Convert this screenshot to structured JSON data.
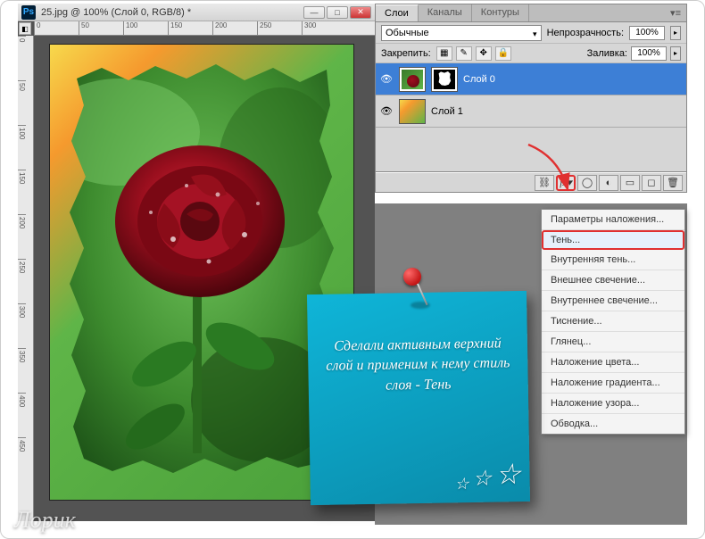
{
  "window": {
    "title": "25.jpg @ 100% (Слой 0, RGB/8) *"
  },
  "ruler_h": [
    "0",
    "50",
    "100",
    "150",
    "200",
    "250",
    "300"
  ],
  "ruler_v": [
    "0",
    "50",
    "100",
    "150",
    "200",
    "250",
    "300",
    "350",
    "400",
    "450"
  ],
  "panel": {
    "tabs": {
      "layers": "Слои",
      "channels": "Каналы",
      "paths": "Контуры"
    },
    "blend_mode": "Обычные",
    "opacity_label": "Непрозрачность:",
    "opacity_value": "100%",
    "lock_label": "Закрепить:",
    "fill_label": "Заливка:",
    "fill_value": "100%",
    "layers": [
      {
        "name": "Слой 0"
      },
      {
        "name": "Слой 1"
      }
    ]
  },
  "fx_menu": {
    "items": [
      "Параметры наложения...",
      "Тень...",
      "Внутренняя тень...",
      "Внешнее свечение...",
      "Внутреннее свечение...",
      "Тиснение...",
      "Глянец...",
      "Наложение цвета...",
      "Наложение градиента...",
      "Наложение узора...",
      "Обводка..."
    ]
  },
  "note": {
    "text": "Сделали активным верхний слой и применим к нему стиль слоя - Тень"
  },
  "watermark": "Лорик"
}
